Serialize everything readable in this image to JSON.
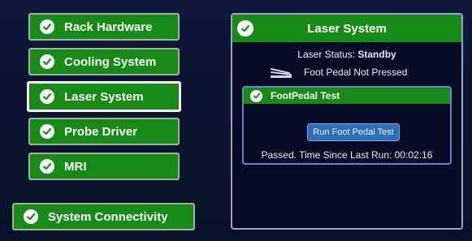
{
  "nav": {
    "rack_hardware": "Rack Hardware",
    "cooling_system": "Cooling System",
    "laser_system": "Laser System",
    "probe_driver": "Probe Driver",
    "mri": "MRI",
    "system_connectivity": "System Connectivity"
  },
  "panel": {
    "title": "Laser System",
    "status_label": "Laser Status:",
    "status_value": "Standby",
    "pedal_state": "Foot Pedal Not Pressed",
    "test": {
      "title": "FootPedal Test",
      "run_button": "Run Foot Pedal Test",
      "result": "Passed. Time Since Last Run: 00:02:16"
    }
  },
  "colors": {
    "green": "#178a17",
    "background": "#0d1330",
    "button_blue": "#2d6fb6"
  },
  "icons": {
    "check": "check-circle-icon",
    "pedal": "foot-pedal-icon"
  }
}
